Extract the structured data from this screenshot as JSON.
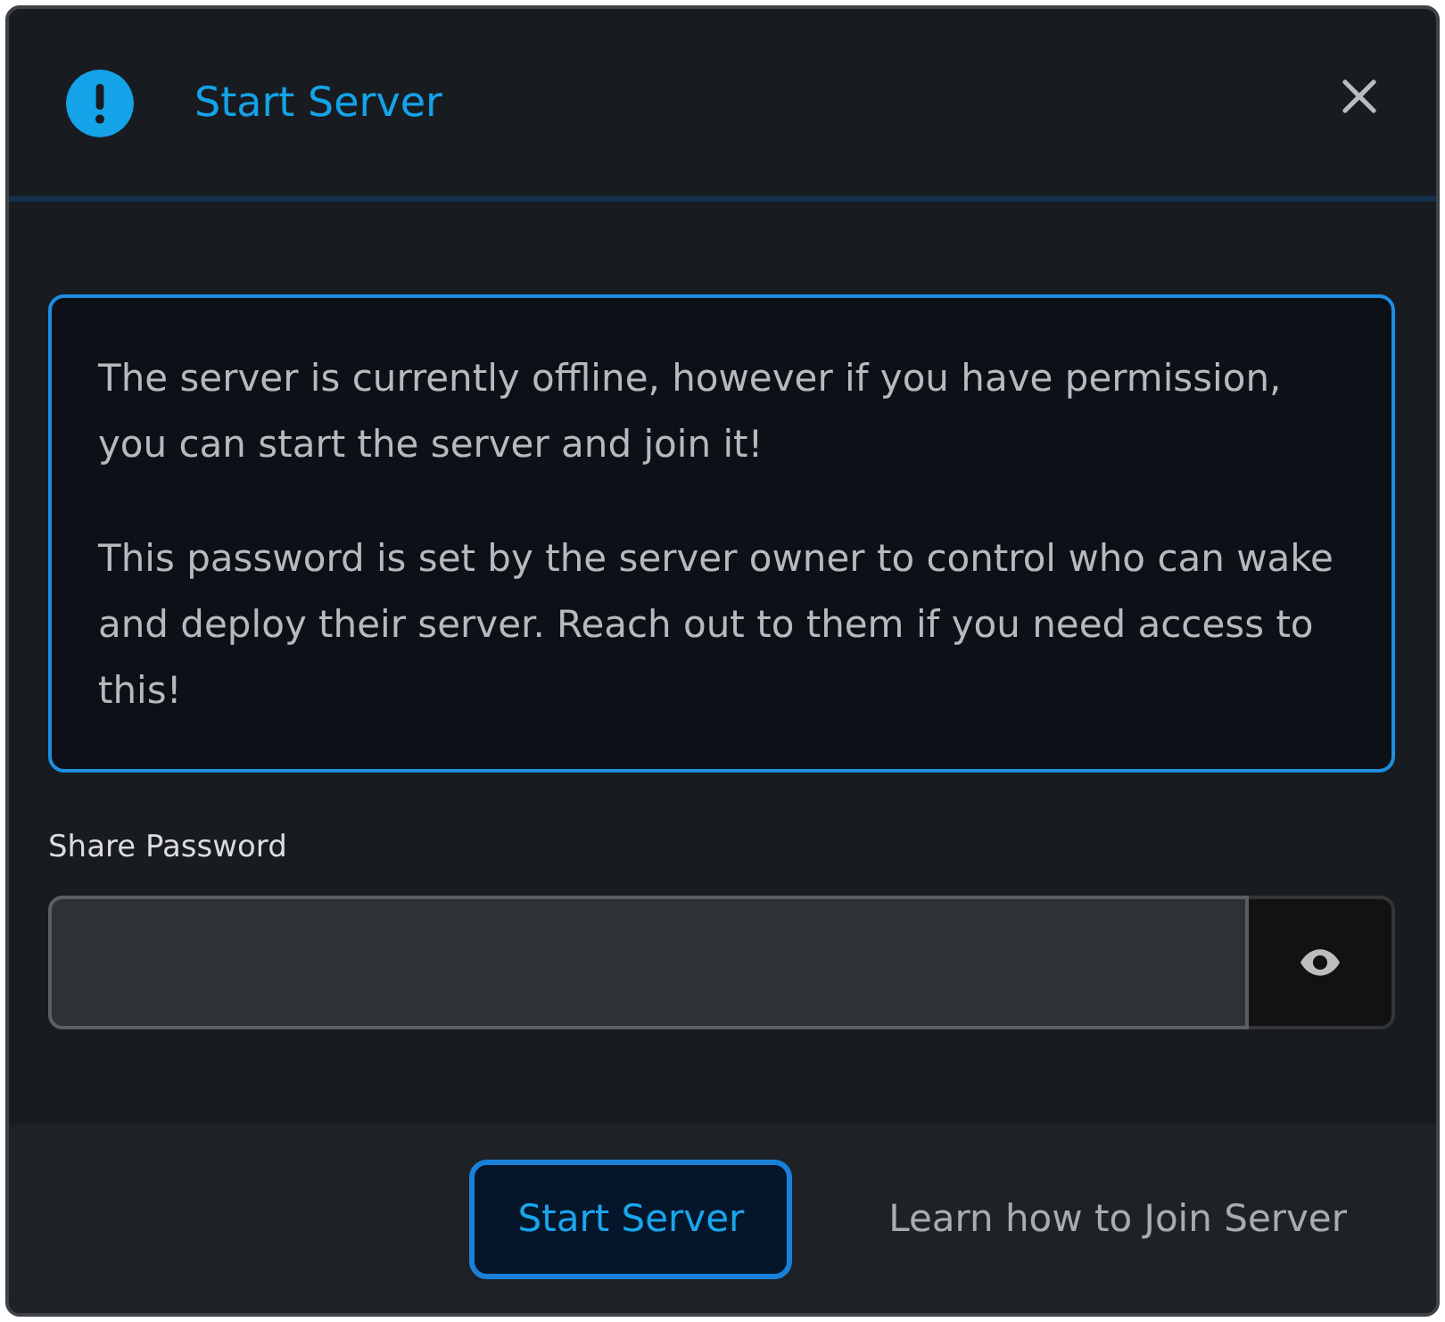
{
  "dialog": {
    "title": "Start Server",
    "closable": true
  },
  "info_box": {
    "paragraphs": [
      "The server is currently offline, however if you have permission, you can start the server and join it!",
      "This password is set by the server owner to control who can wake and deploy their server. Reach out to them if you need access to this!"
    ]
  },
  "password_field": {
    "label": "Share Password"
  },
  "buttons": [
    {
      "label": "Start Server",
      "kind": "primary"
    },
    {
      "label": "Learn how to Join Server",
      "kind": "link"
    }
  ]
}
